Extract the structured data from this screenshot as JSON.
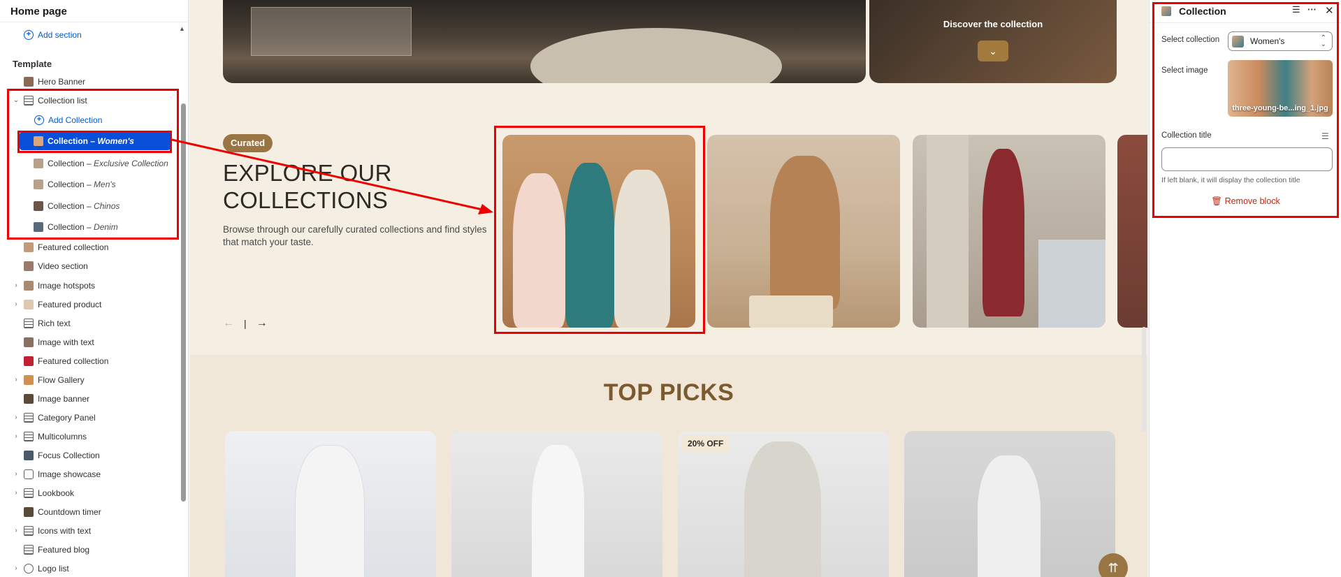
{
  "sidebar": {
    "title": "Home page",
    "add_section": "Add section",
    "template_label": "Template",
    "items": [
      {
        "label": "Hero Banner",
        "thumb": "#8a6a55"
      },
      {
        "label": "Collection list",
        "thumb": "icon-lines"
      },
      {
        "label": "Add Collection"
      },
      {
        "label": "Collection – ",
        "sub": "Women's",
        "thumb": "#d9a57a"
      },
      {
        "label": "Collection – ",
        "sub": "Exclusive Collection",
        "thumb": "#b8a08a"
      },
      {
        "label": "Collection – ",
        "sub": "Men's",
        "thumb": "#b8a08a"
      },
      {
        "label": "Collection – ",
        "sub": "Chinos",
        "thumb": "#6a5548"
      },
      {
        "label": "Collection – ",
        "sub": "Denim",
        "thumb": "#5a6a7a"
      },
      {
        "label": "Featured collection",
        "thumb": "#c19a7a"
      },
      {
        "label": "Video section",
        "thumb": "#9a7a6a"
      },
      {
        "label": "Image hotspots",
        "thumb": "#a88a70"
      },
      {
        "label": "Featured product",
        "thumb": "#e0c8b0"
      },
      {
        "label": "Rich text",
        "thumb": "icon-lines"
      },
      {
        "label": "Image with text",
        "thumb": "#8a7060"
      },
      {
        "label": "Featured collection",
        "thumb": "#c02030"
      },
      {
        "label": "Flow Gallery",
        "thumb": "#d09050"
      },
      {
        "label": "Image banner",
        "thumb": "#5a4a3a"
      },
      {
        "label": "Category Panel",
        "thumb": "icon-lines"
      },
      {
        "label": "Multicolumns",
        "thumb": "icon-lines"
      },
      {
        "label": "Focus Collection",
        "thumb": "#4a5a6a"
      },
      {
        "label": "Image showcase",
        "thumb": "icon-lines"
      },
      {
        "label": "Lookbook",
        "thumb": "icon-lines"
      },
      {
        "label": "Countdown timer",
        "thumb": "#5a4a3a"
      },
      {
        "label": "Icons with text",
        "thumb": "icon-lines"
      },
      {
        "label": "Featured blog",
        "thumb": "icon-lines"
      },
      {
        "label": "Logo list",
        "thumb": "icon-lines"
      }
    ]
  },
  "canvas": {
    "hero": {
      "discover": "Discover the collection"
    },
    "collections": {
      "badge": "Curated",
      "title": "EXPLORE OUR COLLECTIONS",
      "description": "Browse through our carefully curated collections and find styles that match your taste."
    },
    "top_picks": {
      "title": "TOP PICKS",
      "sale_badge": "20% OFF"
    }
  },
  "right_panel": {
    "title": "Collection",
    "select_collection_label": "Select collection",
    "select_collection_value": "Women's",
    "select_image_label": "Select image",
    "image_filename": "three-young-be...ing_1.jpg",
    "collection_title_label": "Collection title",
    "collection_title_value": "",
    "hint": "If left blank, it will display the collection title",
    "remove_block": "Remove block"
  },
  "colors": {
    "accent_blue": "#005bd3",
    "selected_bg": "#0a4fd8",
    "brand_brown": "#9a7544",
    "annotation_red": "#ee0000",
    "danger": "#c5280c"
  }
}
